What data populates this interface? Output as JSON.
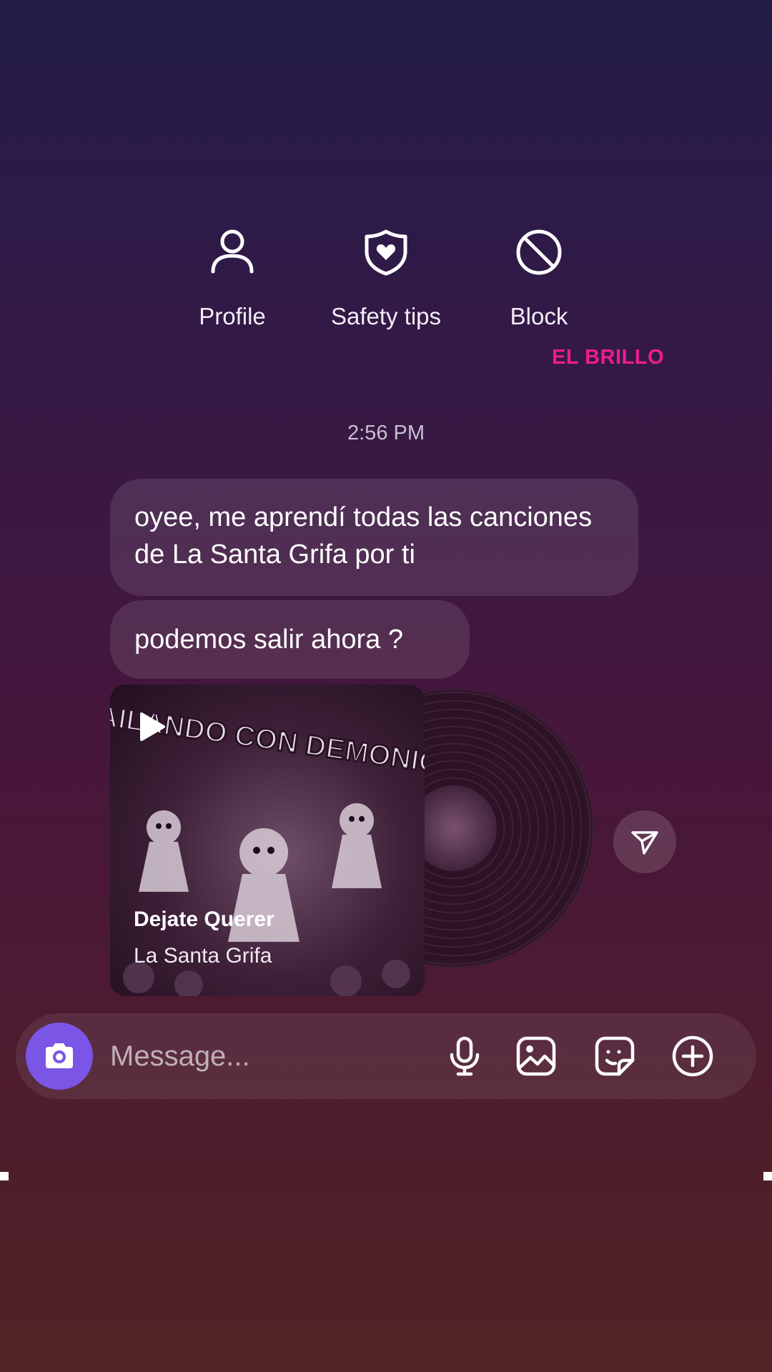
{
  "actions": [
    {
      "label": "Profile",
      "icon": "person-icon"
    },
    {
      "label": "Safety tips",
      "icon": "shield-heart-icon"
    },
    {
      "label": "Block",
      "icon": "block-icon"
    }
  ],
  "brand": "EL BRILLO",
  "timestamp": "2:56 PM",
  "messages": [
    {
      "text": "oyee, me aprendí todas las canciones de La Santa Grifa por ti"
    },
    {
      "text": "podemos salir ahora ?"
    }
  ],
  "music": {
    "title": "Dejate Querer",
    "artist": "La Santa Grifa",
    "cover_text": "BAILANDO CON DEMONIOS"
  },
  "composer": {
    "placeholder": "Message...",
    "icons": [
      "camera-icon",
      "microphone-icon",
      "gallery-icon",
      "sticker-icon",
      "plus-circle-icon"
    ]
  },
  "colors": {
    "accent_brand": "#ee1d8e",
    "camera_button": "#7a55e6"
  }
}
